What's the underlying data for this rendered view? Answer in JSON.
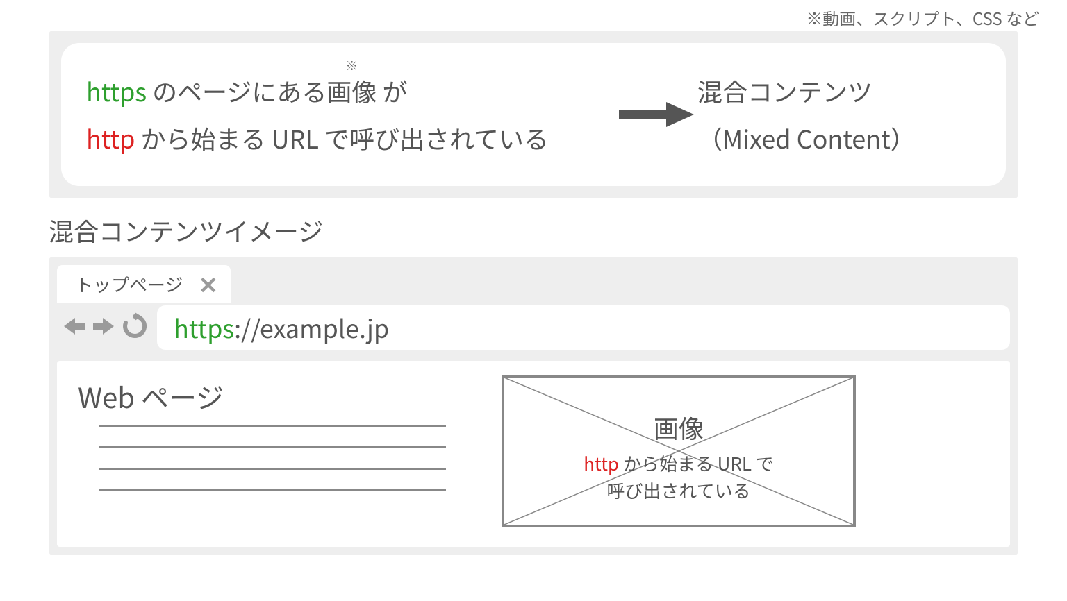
{
  "note": "※動画、スクリプト、CSS など",
  "top_card": {
    "line1_prefix": "https",
    "line1_mid": " のページにある",
    "line1_annot_target": "画像",
    "line1_annot_mark": "※",
    "line1_suffix": " が",
    "line2_prefix": "http",
    "line2_rest": " から始まる URL で呼び出されている",
    "right_line1": "混合コンテンツ",
    "right_line2": "（Mixed Content）"
  },
  "section_heading": "混合コンテンツイメージ",
  "browser": {
    "tab_label": "トップページ",
    "url_scheme": "https",
    "url_rest": "://example.jp",
    "page_title": "Web ページ",
    "image_label": "画像",
    "image_sub_prefix": "http",
    "image_sub_line1_rest": " から始まる URL で",
    "image_sub_line2": "呼び出されている"
  }
}
